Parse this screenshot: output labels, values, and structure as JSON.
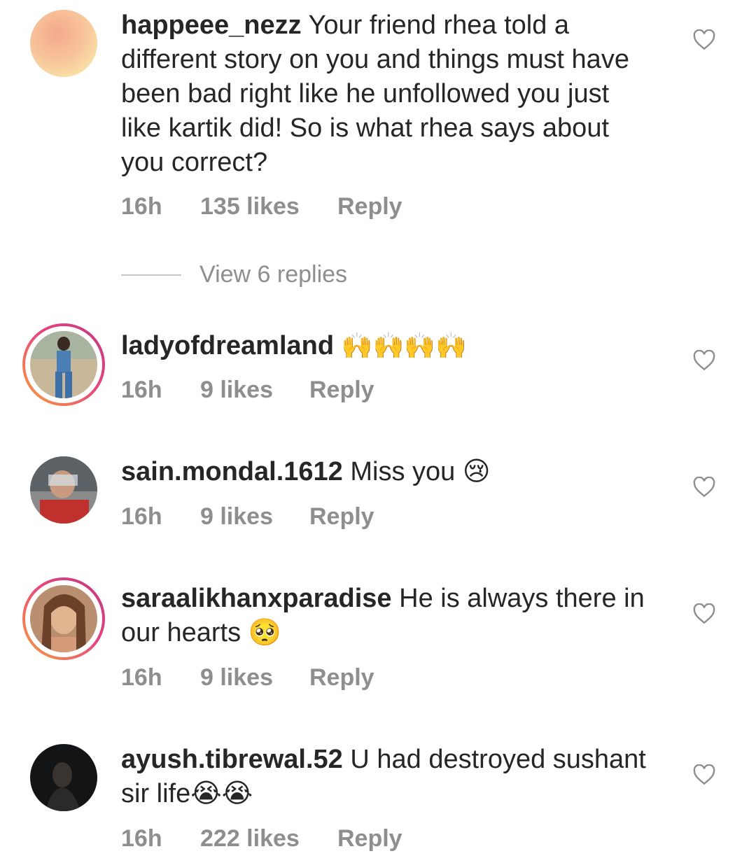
{
  "comments": [
    {
      "username": "happeee_nezz",
      "text": "Your friend rhea told a different story on you and things must have been bad right like he unfollowed you just like kartik did! So is what rhea says about you correct?",
      "time": "16h",
      "likes": "135 likes",
      "reply": "Reply",
      "avatar_color": "#f4b28a",
      "view_replies": "View 6 replies"
    },
    {
      "username": "ladyofdreamland",
      "text": "🙌🙌🙌🙌",
      "time": "16h",
      "likes": "9 likes",
      "reply": "Reply"
    },
    {
      "username": "sain.mondal.1612",
      "text": "Miss you 😢",
      "time": "16h",
      "likes": "9 likes",
      "reply": "Reply"
    },
    {
      "username": "saraalikhanxparadise",
      "text": "He is always there in our hearts 🥺",
      "time": "16h",
      "likes": "9 likes",
      "reply": "Reply"
    },
    {
      "username": "ayush.tibrewal.52",
      "text": "U had destroyed sushant sir life😭😭",
      "time": "16h",
      "likes": "222 likes",
      "reply": "Reply"
    }
  ],
  "icons": {
    "like": "heart-outline-icon"
  },
  "colors": {
    "text": "#262626",
    "meta": "#8e8e8e",
    "story_ring_start": "#f9a13a",
    "story_ring_end": "#c13584"
  }
}
